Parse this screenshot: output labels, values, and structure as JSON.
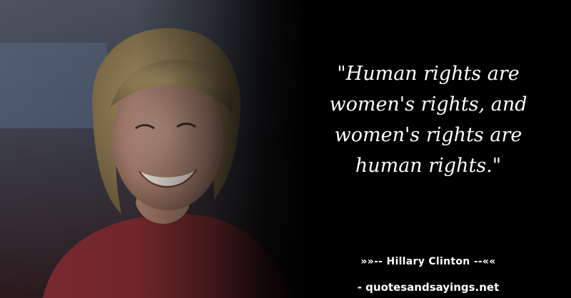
{
  "quote": {
    "lines": [
      "\"Human rights are",
      "women's rights, and",
      "women's rights are",
      "human rights.\""
    ]
  },
  "attribution": "»»-- Hillary Clinton --««",
  "source": "- quotesandsayings.net",
  "colors": {
    "background": "#000000",
    "text": "#ffffff"
  }
}
